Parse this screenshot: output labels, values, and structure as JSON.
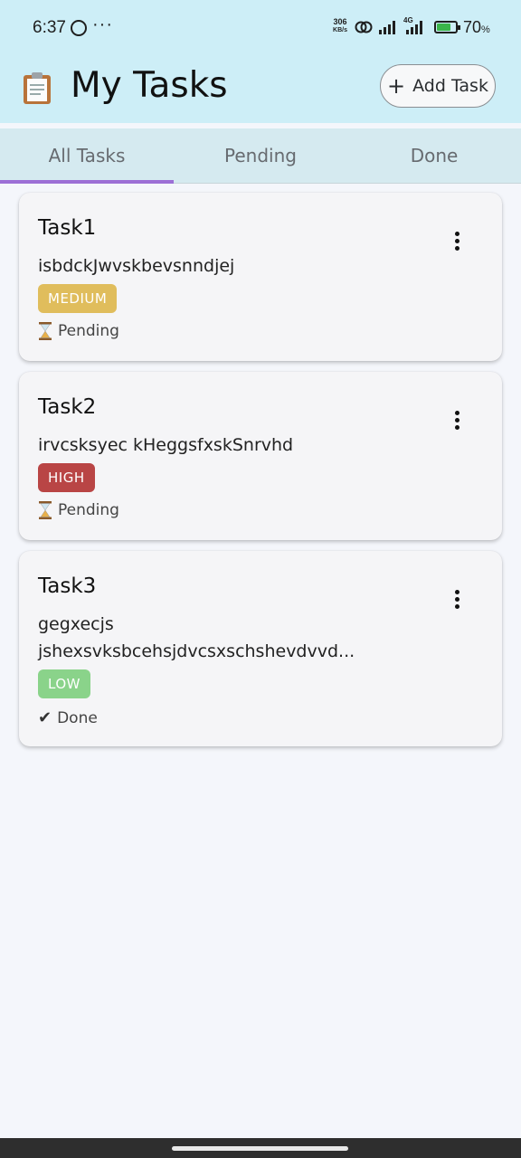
{
  "status_bar": {
    "time": "6:37",
    "more": "···",
    "speed_value": "306",
    "speed_unit": "KB/s",
    "network": "4G",
    "battery_percent": "70",
    "battery_unit": "%",
    "battery_level": 0.7,
    "icons": [
      "whatsapp-icon",
      "link-icon",
      "signal-icon",
      "battery-charging-icon"
    ]
  },
  "header": {
    "title": "My Tasks",
    "title_icon": "clipboard-icon",
    "add_button_label": "Add Task",
    "add_button_icon": "plus-icon"
  },
  "tabs": [
    {
      "label": "All Tasks",
      "active": true
    },
    {
      "label": "Pending",
      "active": false
    },
    {
      "label": "Done",
      "active": false
    }
  ],
  "tasks": [
    {
      "title": "Task1",
      "description": [
        "isbdckJwvskbevsnndjej"
      ],
      "priority": "MEDIUM",
      "status": "Pending",
      "status_icon": "hourglass-icon"
    },
    {
      "title": "Task2",
      "description": [
        "irvcsksyec kHeggsfxskSnrvhd"
      ],
      "priority": "HIGH",
      "status": "Pending",
      "status_icon": "hourglass-icon"
    },
    {
      "title": "Task3",
      "description": [
        "gegxecjs",
        "jshexsvksbcehsjdvcsxschshevdvvd..."
      ],
      "priority": "LOW",
      "status": "Done",
      "status_icon": "checkmark-icon"
    }
  ],
  "colors": {
    "header_bg": "#cdeef7",
    "tab_bg": "#d5eaf0",
    "tab_indicator": "#9c6fd6",
    "priority_medium": "#e0bd5c",
    "priority_high": "#b94545",
    "priority_low": "#8ad38a",
    "page_bg": "#f4f6fb"
  }
}
